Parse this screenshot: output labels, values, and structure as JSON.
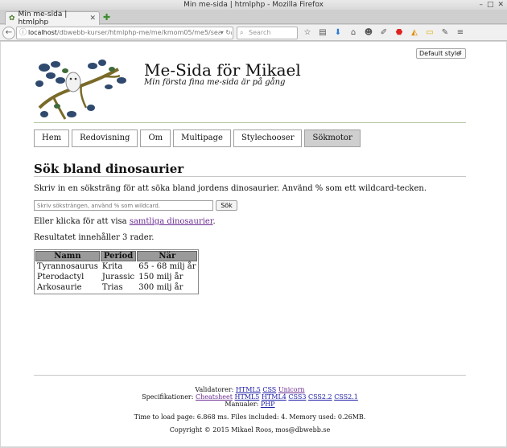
{
  "window": {
    "title": "Min me-sida | htmlphp - Mozilla Firefox"
  },
  "tab": {
    "label": "Min me-sida | htmlphp"
  },
  "url": {
    "host": "localhost",
    "path": "/dbwebb-kurser/htmlphp-me/me/kmom05/me5/search.ph"
  },
  "search": {
    "placeholder": "Search"
  },
  "style_switcher": {
    "value": "Default style"
  },
  "site": {
    "title": "Me-Sida för Mikael",
    "slogan": "Min första fina me-sida är på gång"
  },
  "navigation": [
    {
      "label": "Hem"
    },
    {
      "label": "Redovisning"
    },
    {
      "label": "Om"
    },
    {
      "label": "Multipage"
    },
    {
      "label": "Stylechooser"
    },
    {
      "label": "Sökmotor",
      "active": true
    }
  ],
  "main": {
    "heading": "Sök bland dinosaurier",
    "intro": "Skriv in en söksträng för att söka bland jordens dinosaurier. Använd % som ett wildcard-tecken.",
    "search_placeholder": "Skriv söksträngen, använd % som wildcard.",
    "search_button": "Sök",
    "show_all_prefix": "Eller klicka för att visa ",
    "show_all_link": "samtliga dinosaurier",
    "show_all_suffix": ".",
    "result_text": "Resultatet innehåller 3 rader."
  },
  "table": {
    "headers": [
      "Namn",
      "Period",
      "När"
    ],
    "rows": [
      [
        "Tyrannosaurus",
        "Krita",
        "65 - 68 milj år"
      ],
      [
        "Pterodactyl",
        "Jurassic",
        "150 milj år"
      ],
      [
        "Arkosaurie",
        "Trias",
        "300 milj år"
      ]
    ]
  },
  "footer": {
    "validators_label": "Validatorer: ",
    "validators": [
      "HTML5",
      "CSS",
      "Unicorn"
    ],
    "specs_label": "Specifikationer: ",
    "specs": [
      "Cheatsheet",
      "HTML5",
      "HTML4",
      "CSS3",
      "CSS2.2",
      "CSS2.1"
    ],
    "manuals_label": "Manualer: ",
    "manuals": [
      "PHP"
    ],
    "load_info": "Time to load page: 6.868 ms. Files included: 4. Memory used: 0.26MB.",
    "copyright": "Copyright © 2015 Mikael Roos, mos@dbwebb.se"
  },
  "colors": {
    "link": "#1a1aa6",
    "visited_link": "#6b2c91",
    "active_nav": "#cfcfcf",
    "table_header": "#9a9a9a"
  }
}
